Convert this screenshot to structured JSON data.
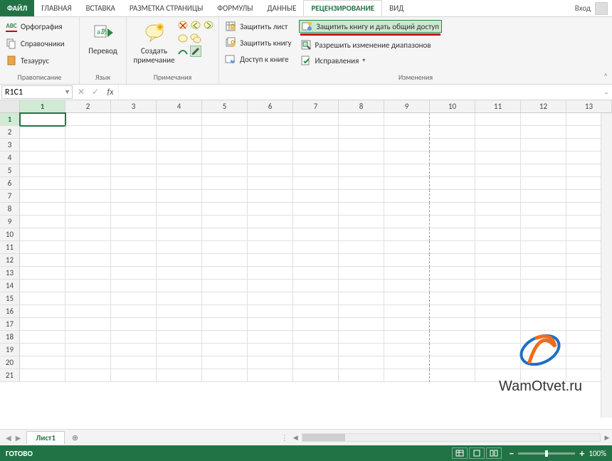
{
  "tabs": {
    "file": "ФАЙЛ",
    "home": "ГЛАВНАЯ",
    "insert": "ВСТАВКА",
    "layout": "РАЗМЕТКА СТРАНИЦЫ",
    "formulas": "ФОРМУЛЫ",
    "data": "ДАННЫЕ",
    "review": "РЕЦЕНЗИРОВАНИЕ",
    "view": "ВИД"
  },
  "account": {
    "signin": "Вход"
  },
  "ribbon": {
    "proofing": {
      "spelling": "Орфография",
      "research": "Справочники",
      "thesaurus": "Тезаурус",
      "label": "Правописание"
    },
    "language": {
      "translate": "Перевод",
      "label": "Язык"
    },
    "comments": {
      "new_comment_l1": "Создать",
      "new_comment_l2": "примечание",
      "label": "Примечания"
    },
    "changes": {
      "protect_sheet": "Защитить лист",
      "protect_workbook": "Защитить книгу",
      "share_workbook": "Доступ к книге",
      "protect_and_share": "Защитить книгу и дать общий доступ",
      "allow_edit_ranges": "Разрешить изменение диапазонов",
      "track_changes": "Исправления",
      "label": "Изменения"
    }
  },
  "namebox": "R1C1",
  "columns": [
    "1",
    "2",
    "3",
    "4",
    "5",
    "6",
    "7",
    "8",
    "9",
    "10",
    "11",
    "12",
    "13"
  ],
  "rows": [
    "1",
    "2",
    "3",
    "4",
    "5",
    "6",
    "7",
    "8",
    "9",
    "10",
    "11",
    "12",
    "13",
    "14",
    "15",
    "16",
    "17",
    "18",
    "19",
    "20",
    "21"
  ],
  "active": {
    "col": 0,
    "row": 0
  },
  "dashed_after_col": 8,
  "sheets": {
    "active": "Лист1"
  },
  "status": {
    "ready": "ГОТОВО",
    "zoom": "100%"
  },
  "watermark": "WamOtvet.ru"
}
